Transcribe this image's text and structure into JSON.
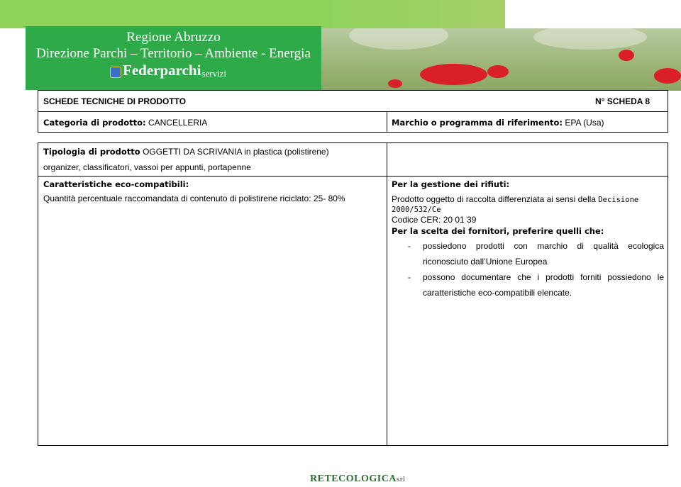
{
  "header": {
    "region": "Regione Abruzzo",
    "department": "Direzione Parchi – Territorio – Ambiente - Energia",
    "logo_main": "Federparchi",
    "logo_sub": "servizi"
  },
  "sheet": {
    "title": "SCHEDE TECNICHE DI PRODOTTO",
    "number": "N° SCHEDA 8",
    "category_label": "Categoria di prodotto:",
    "category_value": "CANCELLERIA",
    "brand_label": "Marchio o programma di riferimento:",
    "brand_value": "EPA (Usa)"
  },
  "product": {
    "type_label": "Tipologia di prodotto",
    "type_value": "OGGETTI DA SCRIVANIA in plastica (polistirene)",
    "type_line2": "organizer, classificatori, vassoi per appunti, portapenne",
    "eco_label": "Caratteristiche eco-compatibili:",
    "eco_value": "Quantità percentuale raccomandata di contenuto di polistirene riciclato: 25- 80%"
  },
  "waste": {
    "label": "Per la gestione dei rifiuti:",
    "line1_a": "Prodotto oggetto di raccolta differenziata ai sensi della",
    "line1_b": "Decisione",
    "line2": "2000/532/Ce",
    "cer": "Codice CER: 20 01 39"
  },
  "suppliers": {
    "label": "Per la scelta dei fornitori, preferire quelli che:",
    "items": [
      {
        "bullet": "-",
        "line1": "possiedono prodotti con marchio di qualità ecologica",
        "line2": "riconosciuto dall’Unione Europea"
      },
      {
        "bullet": "-",
        "line1": "possono documentare che i prodotti forniti possiedono le",
        "line2": "caratteristiche eco-compatibili elencate."
      }
    ]
  },
  "footer": {
    "logo": "RETECOLOGICA",
    "logo_suffix": "srl"
  }
}
